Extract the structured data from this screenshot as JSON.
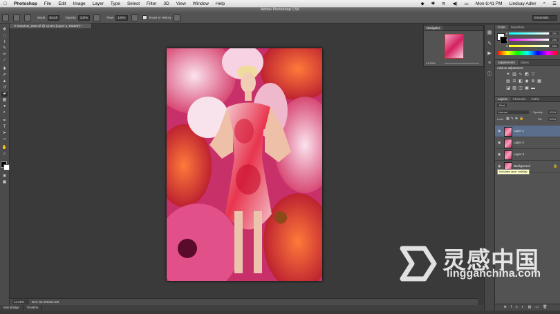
{
  "menubar": {
    "apple": "",
    "app": "Photoshop",
    "items": [
      "File",
      "Edit",
      "Image",
      "Layer",
      "Type",
      "Select",
      "Filter",
      "3D",
      "View",
      "Window",
      "Help"
    ],
    "clock": "Mon 6:41 PM",
    "user": "Lindsay Adler"
  },
  "window_title": "Adobe Photoshop CS6",
  "options": {
    "mode_label": "Mode:",
    "mode_value": "Brush",
    "opacity_label": "Opacity:",
    "opacity_value": "100%",
    "flow_label": "Flow:",
    "flow_value": "100%",
    "erase_history": "Erase to History",
    "workspace": "Essentials"
  },
  "document": {
    "tab": "NaraFox_0001.tif @ 14.3% (Layer 1, RGB/8*) *",
    "zoom": "14.29%",
    "doc_info": "Doc: 66.2M/224.3M"
  },
  "bottom_tabs": [
    "Mini Bridge",
    "Timeline"
  ],
  "navigator": {
    "tabs": [
      "Navigator"
    ],
    "zoom": "14.29%"
  },
  "color_panel": {
    "tabs": [
      "Color",
      "Swatches"
    ],
    "r": "255",
    "g": "255",
    "b": "255",
    "r_label": "R",
    "g_label": "G",
    "b_label": "B"
  },
  "adjustments": {
    "tabs": [
      "Adjustments",
      "Styles"
    ],
    "title": "Add an adjustment"
  },
  "layers_panel": {
    "tabs": [
      "Layers",
      "Channels",
      "Paths"
    ],
    "filter": "Kind",
    "blend": "Normal",
    "opacity_label": "Opacity:",
    "opacity": "100%",
    "lock_label": "Lock:",
    "fill_label": "Fill:",
    "fill": "100%",
    "layers": [
      "Layer 1",
      "Layer 2",
      "Layer 3",
      "Background"
    ],
    "tooltip": "Indicates layer visibility"
  },
  "watermark": {
    "cn": "灵感中国",
    "en": "lingganchina.com"
  },
  "colors": {
    "accent": "#5b6e8c",
    "panel": "#535353",
    "canvas_bg": "#3a3a3a"
  }
}
